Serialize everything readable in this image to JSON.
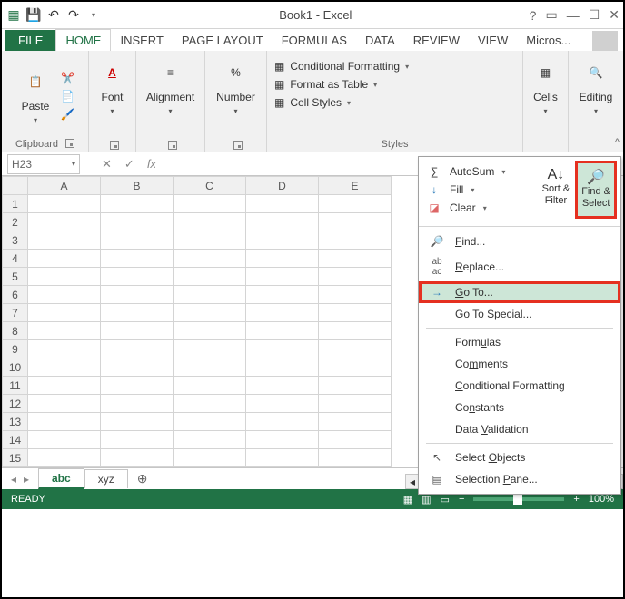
{
  "title": "Book1 - Excel",
  "tabs": {
    "file": "FILE",
    "home": "HOME",
    "insert": "INSERT",
    "pagelayout": "PAGE LAYOUT",
    "formulas": "FORMULAS",
    "data": "DATA",
    "review": "REVIEW",
    "view": "VIEW",
    "account": "Micros..."
  },
  "ribbon": {
    "paste": "Paste",
    "font": "Font",
    "alignment": "Alignment",
    "number": "Number",
    "cond_fmt": "Conditional Formatting",
    "fmt_table": "Format as Table",
    "cell_styles": "Cell Styles",
    "cells": "Cells",
    "editing": "Editing",
    "clipboard_label": "Clipboard",
    "styles_label": "Styles"
  },
  "name_box": "H23",
  "columns": [
    "A",
    "B",
    "C",
    "D",
    "E"
  ],
  "rows_count": 15,
  "sheet_tabs": {
    "active": "abc",
    "other": "xyz"
  },
  "status": {
    "ready": "READY",
    "zoom": "100%"
  },
  "dropdown": {
    "autosum": "AutoSum",
    "fill": "Fill",
    "clear": "Clear",
    "sort_filter": "Sort &\nFilter",
    "find_select": "Find &\nSelect",
    "items": {
      "find": "Find...",
      "replace": "Replace...",
      "goto": "Go To...",
      "goto_special": "Go To Special...",
      "formulas": "Formulas",
      "comments": "Comments",
      "cond_fmt": "Conditional Formatting",
      "constants": "Constants",
      "data_validation": "Data Validation",
      "select_objects": "Select Objects",
      "selection_pane": "Selection Pane..."
    },
    "underline": {
      "find": "F",
      "replace": "R",
      "goto": "G",
      "goto_special": "S",
      "formulas": "u",
      "comments": "m",
      "cond_fmt": "C",
      "constants": "n",
      "data_validation": "V",
      "select_objects": "O",
      "selection_pane": "P"
    }
  }
}
